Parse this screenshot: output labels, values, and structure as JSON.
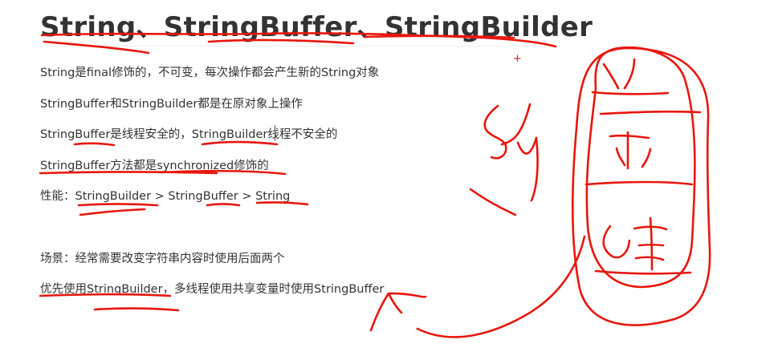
{
  "doc": {
    "title": "String、StringBuffer、StringBuilder",
    "lines": [
      "String是final修饰的，不可变，每次操作都会产生新的String对象",
      "StringBuffer和StringBuilder都是在原对象上操作",
      "StringBuffer是线程安全的，StringBuilder线程不安全的",
      "StringBuffer方法都是synchronized修饰的",
      "性能：StringBuilder > StringBuffer > String",
      "场景：经常需要改变字符串内容时使用后面两个",
      "优先使用StringBuilder，多线程使用共享变量时使用StringBuffer"
    ]
  },
  "annotations": {
    "plus_mark": "+",
    "ink_color": "#e8160c"
  }
}
